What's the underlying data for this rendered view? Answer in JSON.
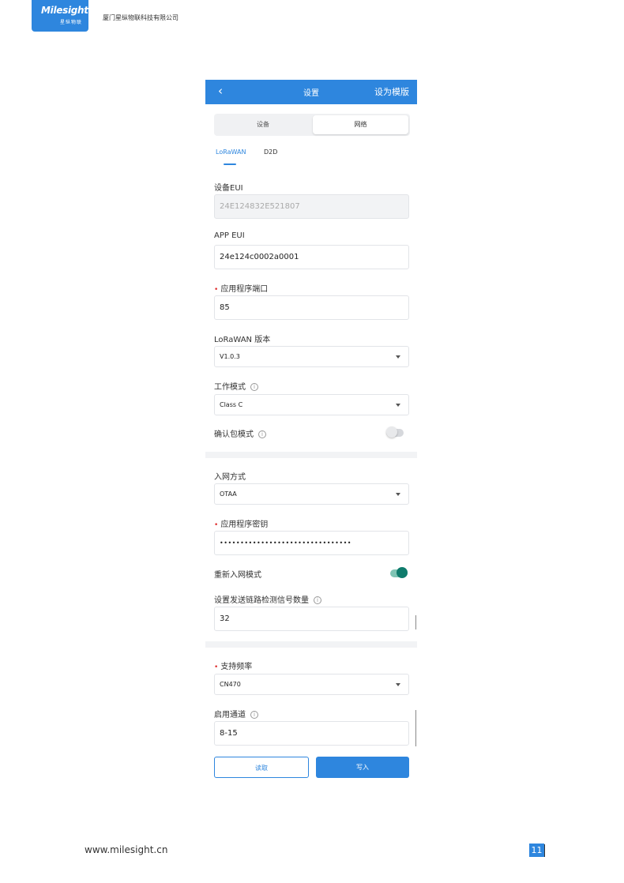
{
  "header": {
    "logo_text": "Milesight",
    "logo_sub": "星纵物联",
    "company": "厦门星纵物联科技有限公司"
  },
  "app": {
    "back_icon": "‹",
    "title": "设置",
    "template_button": "设为模版",
    "segments": [
      "设备",
      "网络"
    ],
    "selected_segment": "网络",
    "subtabs": [
      "LoRaWAN",
      "D2D"
    ],
    "active_subtab": "LoRaWAN",
    "device_eui": {
      "label": "设备EUI",
      "value": "24E124832E521807"
    },
    "app_eui": {
      "label": "APP EUI",
      "value": "24e124c0002a0001"
    },
    "app_port": {
      "required": "•",
      "label": "应用程序端口",
      "value": "85"
    },
    "lorawan_version": {
      "label": "LoRaWAN 版本",
      "value": "V1.0.3"
    },
    "work_mode": {
      "label": "工作模式",
      "info": "i",
      "value": "Class C"
    },
    "confirm_mode": {
      "label": "确认包模式",
      "info": "i",
      "enabled": false
    },
    "join_type": {
      "label": "入网方式",
      "value": "OTAA"
    },
    "app_key": {
      "required": "•",
      "label": "应用程序密钥",
      "value": "••••••••••••••••••••••••••••••••"
    },
    "rejoin_mode": {
      "label": "重新入网模式",
      "enabled": true
    },
    "link_check": {
      "label": "设置发送链路检测信号数量",
      "info": "i",
      "value": "32"
    },
    "frequency": {
      "required": "•",
      "label": "支持频率",
      "value": "CN470"
    },
    "channels": {
      "label": "启用通道",
      "info": "i",
      "value": "8-15"
    },
    "read_button": "读取",
    "write_button": "写入"
  },
  "footer": {
    "url": "www.milesight.cn",
    "page": "11"
  },
  "colors": {
    "primary": "#2e86de",
    "toggle_on": "#0f7b6c",
    "required": "#e03131"
  }
}
